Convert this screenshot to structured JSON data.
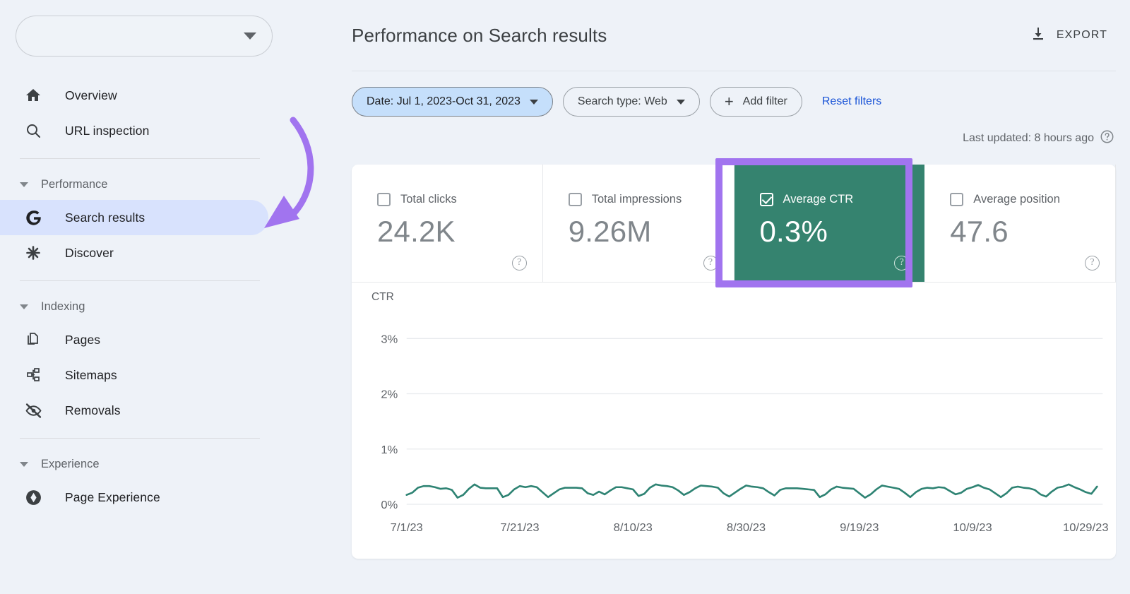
{
  "sidebar": {
    "property_selector": {
      "value": "",
      "placeholder": ""
    },
    "items": [
      {
        "label": "Overview",
        "icon": "home-icon",
        "name": "overview"
      },
      {
        "label": "URL inspection",
        "icon": "search-icon",
        "name": "url-inspection"
      }
    ],
    "groups": [
      {
        "label": "Performance",
        "name": "performance",
        "items": [
          {
            "label": "Search results",
            "icon": "google-g-icon",
            "name": "search-results",
            "active": true
          },
          {
            "label": "Discover",
            "icon": "asterisk-icon",
            "name": "discover",
            "active": false
          }
        ]
      },
      {
        "label": "Indexing",
        "name": "indexing",
        "items": [
          {
            "label": "Pages",
            "icon": "pages-icon",
            "name": "pages",
            "active": false
          },
          {
            "label": "Sitemaps",
            "icon": "sitemap-icon",
            "name": "sitemaps",
            "active": false
          },
          {
            "label": "Removals",
            "icon": "eye-off-icon",
            "name": "removals",
            "active": false
          }
        ]
      },
      {
        "label": "Experience",
        "name": "experience",
        "items": [
          {
            "label": "Page Experience",
            "icon": "page-experience-icon",
            "name": "page-experience",
            "active": false
          }
        ]
      }
    ]
  },
  "header": {
    "title": "Performance on Search results",
    "export_label": "EXPORT",
    "export_icon": "download-icon"
  },
  "filters": {
    "date_chip": {
      "label": "Date: Jul 1, 2023-Oct 31, 2023",
      "selected": true
    },
    "search_type_chip": {
      "label": "Search type: Web",
      "selected": false
    },
    "add_filter": {
      "label": "Add filter",
      "icon": "plus-icon"
    },
    "reset": {
      "label": "Reset filters"
    },
    "last_updated": {
      "text": "Last updated: 8 hours ago",
      "help_icon": "help-icon"
    }
  },
  "metrics": [
    {
      "label": "Total clicks",
      "value": "24.2K",
      "checked": false,
      "highlighted": false
    },
    {
      "label": "Total impressions",
      "value": "9.26M",
      "checked": false,
      "highlighted": false
    },
    {
      "label": "Average CTR",
      "value": "0.3%",
      "checked": true,
      "highlighted": true
    },
    {
      "label": "Average position",
      "value": "47.6",
      "checked": false,
      "highlighted": false
    }
  ],
  "colors": {
    "page_background": "#eef2f8",
    "card_background": "#ffffff",
    "active_nav_pill": "#d8e2fd",
    "selected_chip": "#c5dffb",
    "highlight_metric_teal": "#35836f",
    "annotation_purple": "#a174ef",
    "chart_line_teal": "#2e8373",
    "link_blue": "#1a54d7"
  },
  "chart_data": {
    "type": "line",
    "title": "",
    "ylabel": "CTR",
    "xlabel": "",
    "ylim": [
      0,
      3.4
    ],
    "yticks": [
      0,
      1,
      2,
      3
    ],
    "ytick_labels": [
      "0%",
      "1%",
      "2%",
      "3%"
    ],
    "grid": true,
    "legend": "none",
    "series_color": "#2e8373",
    "xtick_labels": [
      "7/1/23",
      "7/21/23",
      "8/10/23",
      "8/30/23",
      "9/19/23",
      "10/9/23",
      "10/29/23"
    ],
    "xtick_positions": [
      0,
      20,
      40,
      60,
      80,
      100,
      120
    ],
    "x_range": [
      0,
      123
    ],
    "series": [
      {
        "name": "Average CTR",
        "unit": "%",
        "values": [
          0.17,
          0.21,
          0.3,
          0.33,
          0.33,
          0.31,
          0.28,
          0.29,
          0.26,
          0.12,
          0.17,
          0.28,
          0.36,
          0.3,
          0.29,
          0.29,
          0.29,
          0.13,
          0.17,
          0.27,
          0.33,
          0.31,
          0.33,
          0.31,
          0.22,
          0.13,
          0.2,
          0.27,
          0.3,
          0.3,
          0.3,
          0.29,
          0.2,
          0.17,
          0.23,
          0.18,
          0.25,
          0.31,
          0.31,
          0.29,
          0.27,
          0.15,
          0.19,
          0.3,
          0.36,
          0.34,
          0.33,
          0.31,
          0.25,
          0.17,
          0.22,
          0.29,
          0.34,
          0.33,
          0.32,
          0.3,
          0.2,
          0.14,
          0.21,
          0.28,
          0.34,
          0.32,
          0.31,
          0.29,
          0.22,
          0.16,
          0.26,
          0.29,
          0.29,
          0.29,
          0.28,
          0.27,
          0.26,
          0.13,
          0.18,
          0.27,
          0.32,
          0.3,
          0.29,
          0.28,
          0.2,
          0.12,
          0.18,
          0.27,
          0.34,
          0.32,
          0.3,
          0.28,
          0.21,
          0.13,
          0.22,
          0.28,
          0.3,
          0.29,
          0.31,
          0.3,
          0.24,
          0.18,
          0.21,
          0.28,
          0.31,
          0.35,
          0.3,
          0.27,
          0.2,
          0.13,
          0.2,
          0.3,
          0.32,
          0.3,
          0.29,
          0.26,
          0.18,
          0.14,
          0.23,
          0.3,
          0.32,
          0.36,
          0.31,
          0.27,
          0.22,
          0.19,
          0.32
        ]
      }
    ]
  },
  "annotations": {
    "arrow": {
      "name": "purple-arrow-annotation",
      "color": "#a174ef",
      "points_to": "Search results"
    },
    "box": {
      "name": "purple-highlight-box",
      "color": "#a174ef",
      "surrounds": "Average CTR"
    }
  }
}
